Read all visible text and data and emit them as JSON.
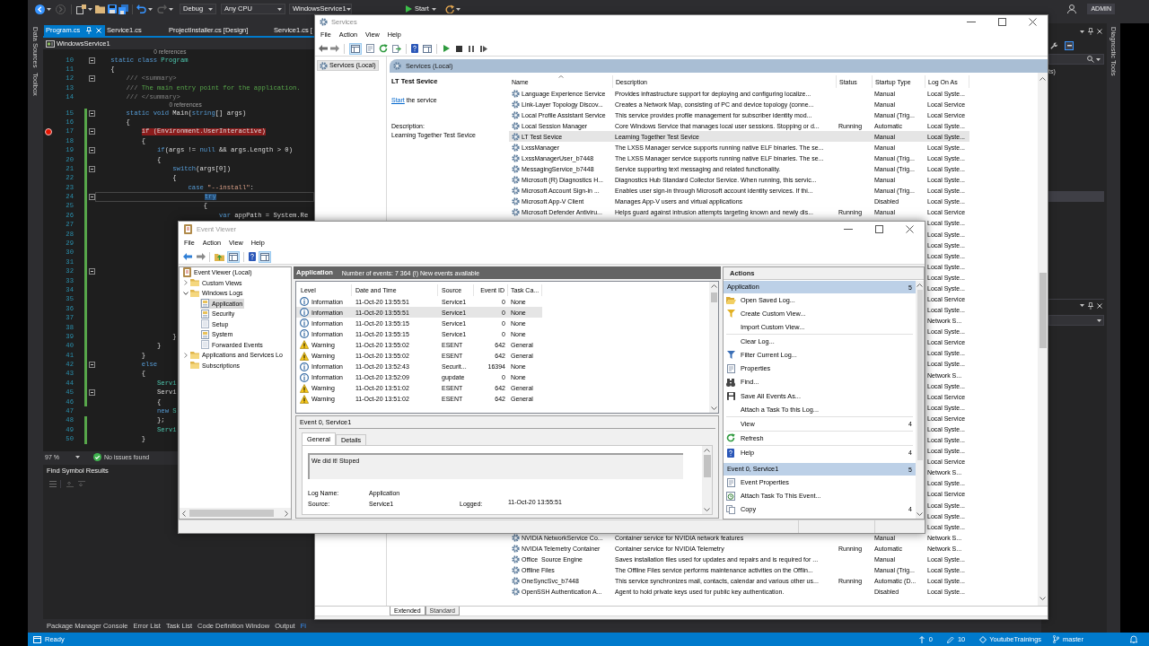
{
  "visual_studio": {
    "toolbar": {
      "configuration": "Debug",
      "platform": "Any CPU",
      "startup_project": "WindowsService1",
      "start_button": "Start",
      "account": "ADMIN"
    },
    "left_tool_tabs": [
      "Data Sources",
      "Toolbox"
    ],
    "right_tool_tabs": [
      "Diagnostic Tools"
    ],
    "document_tabs": [
      {
        "label": "Program.cs",
        "selected": true
      },
      {
        "label": "Service1.cs",
        "selected": false
      },
      {
        "label": "ProjectInstaller.cs [Design]",
        "selected": false
      },
      {
        "label": "Service1.cs [",
        "selected": false
      }
    ],
    "navigation_scope": "WindowsService1",
    "code_lines": [
      {
        "number": "10",
        "codelens": "0 references",
        "fold": true,
        "changed": false,
        "breakpoint": false,
        "current": false,
        "tokens": [
          {
            "text": "    static class ",
            "kind": "keyword"
          },
          {
            "text": "Program",
            "kind": "type"
          }
        ]
      },
      {
        "number": "11",
        "fold": false,
        "changed": false,
        "breakpoint": false,
        "current": false,
        "tokens": [
          {
            "text": "    {",
            "kind": "plain"
          }
        ]
      },
      {
        "number": "12",
        "fold": true,
        "changed": false,
        "breakpoint": false,
        "current": false,
        "tokens": [
          {
            "text": "        /// <summary>",
            "kind": "doc"
          }
        ]
      },
      {
        "number": "13",
        "fold": false,
        "changed": false,
        "breakpoint": false,
        "current": false,
        "tokens": [
          {
            "text": "        ///",
            "kind": "doc"
          },
          {
            "text": " The main entry point for the application.",
            "kind": "comment"
          }
        ]
      },
      {
        "number": "14",
        "fold": false,
        "changed": false,
        "breakpoint": false,
        "current": false,
        "tokens": [
          {
            "text": "        /// </summary>",
            "kind": "doc"
          }
        ]
      },
      {
        "number": "15",
        "codelens": "0 references",
        "fold": true,
        "changed": true,
        "breakpoint": false,
        "current": false,
        "tokens": [
          {
            "text": "        static void ",
            "kind": "keyword"
          },
          {
            "text": "Main(",
            "kind": "plain"
          },
          {
            "text": "string",
            "kind": "keyword"
          },
          {
            "text": "[] args)",
            "kind": "plain"
          }
        ]
      },
      {
        "number": "16",
        "fold": false,
        "changed": true,
        "breakpoint": false,
        "current": false,
        "tokens": [
          {
            "text": "        {",
            "kind": "plain"
          }
        ]
      },
      {
        "number": "17",
        "fold": true,
        "changed": true,
        "breakpoint": true,
        "current": false,
        "tokens": [
          {
            "text": "            if (Environment.UserInteractive)",
            "kind": "plain"
          }
        ]
      },
      {
        "number": "18",
        "fold": false,
        "changed": true,
        "breakpoint": false,
        "current": false,
        "tokens": [
          {
            "text": "            {",
            "kind": "plain"
          }
        ]
      },
      {
        "number": "19",
        "fold": true,
        "changed": true,
        "breakpoint": false,
        "current": false,
        "tokens": [
          {
            "text": "                if",
            "kind": "keyword"
          },
          {
            "text": "(args != ",
            "kind": "plain"
          },
          {
            "text": "null",
            "kind": "keyword"
          },
          {
            "text": " && args.Length > 0)",
            "kind": "plain"
          }
        ]
      },
      {
        "number": "20",
        "fold": false,
        "changed": true,
        "breakpoint": false,
        "current": false,
        "tokens": [
          {
            "text": "                {",
            "kind": "plain"
          }
        ]
      },
      {
        "number": "21",
        "fold": true,
        "changed": true,
        "breakpoint": false,
        "current": false,
        "tokens": [
          {
            "text": "                    switch",
            "kind": "keyword"
          },
          {
            "text": "(args[0])",
            "kind": "plain"
          }
        ]
      },
      {
        "number": "22",
        "fold": false,
        "changed": true,
        "breakpoint": false,
        "current": false,
        "tokens": [
          {
            "text": "                    {",
            "kind": "plain"
          }
        ]
      },
      {
        "number": "23",
        "fold": false,
        "changed": true,
        "breakpoint": false,
        "current": false,
        "tokens": [
          {
            "text": "                        case ",
            "kind": "keyword"
          },
          {
            "text": "\"--install\"",
            "kind": "string"
          },
          {
            "text": ":",
            "kind": "plain"
          }
        ]
      },
      {
        "number": "24",
        "fold": true,
        "changed": true,
        "breakpoint": false,
        "current": true,
        "tokens": [
          {
            "text": "                            try",
            "kind": "keyword"
          }
        ]
      },
      {
        "number": "25",
        "fold": false,
        "changed": true,
        "breakpoint": false,
        "current": false,
        "tokens": [
          {
            "text": "                            {",
            "kind": "plain"
          }
        ]
      },
      {
        "number": "26",
        "fold": false,
        "changed": true,
        "breakpoint": false,
        "current": false,
        "tokens": [
          {
            "text": "                                var ",
            "kind": "keyword"
          },
          {
            "text": "appPath = System.Re",
            "kind": "plain"
          }
        ]
      },
      {
        "number": "27",
        "fold": false,
        "changed": true,
        "breakpoint": false,
        "current": false
      },
      {
        "number": "28",
        "fold": false,
        "changed": true,
        "breakpoint": false,
        "current": false
      },
      {
        "number": "29",
        "fold": false,
        "changed": true,
        "breakpoint": false,
        "current": false
      },
      {
        "number": "30",
        "fold": false,
        "changed": true,
        "breakpoint": false,
        "current": false
      },
      {
        "number": "31",
        "fold": false,
        "changed": true,
        "breakpoint": false,
        "current": false
      },
      {
        "number": "32",
        "fold": true,
        "changed": true,
        "breakpoint": false,
        "current": false
      },
      {
        "number": "33",
        "fold": false,
        "changed": true,
        "breakpoint": false,
        "current": false
      },
      {
        "number": "34",
        "fold": false,
        "changed": true,
        "breakpoint": false,
        "current": false
      },
      {
        "number": "35",
        "fold": false,
        "changed": true,
        "breakpoint": false,
        "current": false
      },
      {
        "number": "36",
        "fold": false,
        "changed": true,
        "breakpoint": false,
        "current": false
      },
      {
        "number": "37",
        "fold": false,
        "changed": true,
        "breakpoint": false,
        "current": false
      },
      {
        "number": "38",
        "fold": false,
        "changed": true,
        "breakpoint": false,
        "current": false
      },
      {
        "number": "39",
        "fold": false,
        "changed": true,
        "breakpoint": false,
        "current": false,
        "tokens": [
          {
            "text": "                    }",
            "kind": "plain"
          }
        ]
      },
      {
        "number": "40",
        "fold": false,
        "changed": true,
        "breakpoint": false,
        "current": false,
        "tokens": [
          {
            "text": "                }",
            "kind": "plain"
          }
        ]
      },
      {
        "number": "41",
        "fold": false,
        "changed": true,
        "breakpoint": false,
        "current": false,
        "tokens": [
          {
            "text": "            }",
            "kind": "plain"
          }
        ]
      },
      {
        "number": "42",
        "fold": true,
        "changed": true,
        "breakpoint": false,
        "current": false,
        "tokens": [
          {
            "text": "            else",
            "kind": "keyword"
          }
        ]
      },
      {
        "number": "43",
        "fold": false,
        "changed": true,
        "breakpoint": false,
        "current": false,
        "tokens": [
          {
            "text": "            {",
            "kind": "plain"
          }
        ]
      },
      {
        "number": "44",
        "fold": false,
        "changed": true,
        "breakpoint": false,
        "current": false,
        "tokens": [
          {
            "text": "                Servi",
            "kind": "type"
          }
        ]
      },
      {
        "number": "45",
        "fold": true,
        "changed": true,
        "breakpoint": false,
        "current": false,
        "tokens": [
          {
            "text": "                Servi",
            "kind": "plain"
          }
        ]
      },
      {
        "number": "46",
        "fold": false,
        "changed": true,
        "breakpoint": false,
        "current": false,
        "tokens": [
          {
            "text": "                {",
            "kind": "plain"
          }
        ]
      },
      {
        "number": "47",
        "fold": false,
        "changed": false,
        "breakpoint": false,
        "current": false,
        "tokens": [
          {
            "text": "                new",
            "kind": "keyword"
          },
          {
            "text": " S",
            "kind": "type"
          }
        ]
      },
      {
        "number": "48",
        "fold": false,
        "changed": true,
        "breakpoint": false,
        "current": false,
        "tokens": [
          {
            "text": "                };",
            "kind": "plain"
          }
        ]
      },
      {
        "number": "49",
        "fold": false,
        "changed": true,
        "breakpoint": false,
        "current": false,
        "tokens": [
          {
            "text": "                Servi",
            "kind": "type"
          }
        ]
      },
      {
        "number": "50",
        "fold": false,
        "changed": true,
        "breakpoint": false,
        "current": false,
        "tokens": [
          {
            "text": "            }",
            "kind": "plain"
          }
        ]
      }
    ],
    "zoom_level": "97 %",
    "issues": "No issues found",
    "find_symbol_results": {
      "title": "Find Symbol Results"
    },
    "tool_tabs": [
      {
        "label": "Package Manager Console",
        "selected": false
      },
      {
        "label": "Error List",
        "selected": false
      },
      {
        "label": "Task List",
        "selected": false
      },
      {
        "label": "Code Definition Window",
        "selected": false
      },
      {
        "label": "Output",
        "selected": false
      },
      {
        "label": "Fi",
        "selected": true
      }
    ],
    "side_panel": {
      "text": "ts)"
    },
    "status_bar": {
      "text": "Ready",
      "outgoing": "0",
      "changes": "10",
      "repository": "YoutubeTrainings",
      "branch": "master"
    }
  },
  "services": {
    "title": "Services",
    "menu": [
      "File",
      "Action",
      "View",
      "Help"
    ],
    "toolbar": {
      "show_tree": true
    },
    "tree": [
      {
        "label": "Services (Local)",
        "selected": true
      }
    ],
    "header": "Services (Local)",
    "details": {
      "title": "LT Test Sevice",
      "action_link": "Start",
      "action_text": "the service",
      "description_label": "Description:",
      "description": "Learning Together Test Sevice"
    },
    "columns": [
      {
        "label": "Name",
        "sorted": true
      },
      {
        "label": "Description",
        "sorted": false
      },
      {
        "label": "Status",
        "sorted": false
      },
      {
        "label": "Startup Type",
        "sorted": false
      },
      {
        "label": "Log On As",
        "sorted": false
      }
    ],
    "rows": [
      {
        "name": "Language Experience Service",
        "description": "Provides infrastructure support for deploying and configuring localize...",
        "startup_type": "Manual",
        "log_on_as": "Local Syste...",
        "selected": false
      },
      {
        "name": "Link-Layer Topology Discov...",
        "description": "Creates a Network Map, consisting of PC and device topology (conne...",
        "startup_type": "Manual",
        "log_on_as": "Local Service",
        "selected": false
      },
      {
        "name": "Local Profile Assistant Service",
        "description": "This service provides profile management for subscriber identity mod...",
        "startup_type": "Manual (Trig...",
        "log_on_as": "Local Service",
        "selected": false
      },
      {
        "name": "Local Session Manager",
        "description": "Core Windows Service that manages local user sessions. Stopping or d...",
        "status": "Running",
        "startup_type": "Automatic",
        "log_on_as": "Local Syste...",
        "selected": false
      },
      {
        "name": "LT Test Sevice",
        "description": "Learning Together Test Sevice",
        "startup_type": "Manual",
        "log_on_as": "Local Syste...",
        "selected": true
      },
      {
        "name": "LxssManager",
        "description": "The LXSS Manager service supports running native ELF binaries. The se...",
        "startup_type": "Manual",
        "log_on_as": "Local Syste...",
        "selected": false
      },
      {
        "name": "LxssManagerUser_b7448",
        "description": "The LXSS Manager service supports running native ELF binaries. The se...",
        "startup_type": "Manual (Trig...",
        "log_on_as": "Local Syste...",
        "selected": false
      },
      {
        "name": "MessagingService_b7448",
        "description": "Service supporting text messaging and related functionality.",
        "startup_type": "Manual (Trig...",
        "log_on_as": "Local Syste...",
        "selected": false
      },
      {
        "name": "Microsoft (R) Diagnostics H...",
        "description": "Diagnostics Hub Standard Collector Service. When running, this servic...",
        "startup_type": "Manual",
        "log_on_as": "Local Syste...",
        "selected": false
      },
      {
        "name": "Microsoft Account Sign-in ...",
        "description": "Enables user sign-in through Microsoft account identity services. If thi...",
        "startup_type": "Manual (Trig...",
        "log_on_as": "Local Syste...",
        "selected": false
      },
      {
        "name": "Microsoft App-V Client",
        "description": "Manages App-V users and virtual applications",
        "startup_type": "Disabled",
        "log_on_as": "Local Syste...",
        "selected": false
      },
      {
        "name": "Microsoft Defender Antiviru...",
        "description": "Helps guard against intrusion attempts targeting known and newly dis...",
        "status": "Running",
        "startup_type": "Manual",
        "log_on_as": "Local Service",
        "selected": false
      },
      {
        "log_on_as": "Local Syste...",
        "selected": false
      },
      {
        "log_on_as": "Local Syste...",
        "selected": false
      },
      {
        "log_on_as": "Local Syste...",
        "selected": false
      },
      {
        "log_on_as": "Local Syste...",
        "selected": false
      },
      {
        "log_on_as": "Local Syste...",
        "selected": false
      },
      {
        "log_on_as": "Local Syste...",
        "selected": false
      },
      {
        "log_on_as": "Local Syste...",
        "selected": false
      },
      {
        "log_on_as": "Local Service",
        "selected": false
      },
      {
        "log_on_as": "Local Syste...",
        "selected": false
      },
      {
        "log_on_as": "Network S...",
        "selected": false
      },
      {
        "log_on_as": "Local Syste...",
        "selected": false
      },
      {
        "log_on_as": "Local Service",
        "selected": false
      },
      {
        "log_on_as": "Local Syste...",
        "selected": false
      },
      {
        "log_on_as": "Local Syste...",
        "selected": false
      },
      {
        "log_on_as": "Network S...",
        "selected": false
      },
      {
        "log_on_as": "Local Syste...",
        "selected": false
      },
      {
        "log_on_as": "Local Service",
        "selected": false
      },
      {
        "log_on_as": "Local Syste...",
        "selected": false
      },
      {
        "log_on_as": "Local Service",
        "selected": false
      },
      {
        "log_on_as": "Local Syste...",
        "selected": false
      },
      {
        "log_on_as": "Local Syste...",
        "selected": false
      },
      {
        "log_on_as": "Local Syste...",
        "selected": false
      },
      {
        "log_on_as": "Local Service",
        "selected": false
      },
      {
        "log_on_as": "Network S...",
        "selected": false
      },
      {
        "log_on_as": "Local Syste...",
        "selected": false
      },
      {
        "log_on_as": "Local Service",
        "selected": false
      },
      {
        "log_on_as": "Local Syste...",
        "selected": false
      },
      {
        "log_on_as": "Local Syste...",
        "selected": false
      },
      {
        "log_on_as": "Local Syste...",
        "selected": false
      },
      {
        "name": "NVIDIA NetworkService Co...",
        "description": "Container service for NVIDIA network features",
        "startup_type": "Manual",
        "log_on_as": "Network S...",
        "selected": false
      },
      {
        "name": "NVIDIA Telemetry Container",
        "description": "Container service for NVIDIA Telemetry",
        "status": "Running",
        "startup_type": "Automatic",
        "log_on_as": "Network S...",
        "selected": false
      },
      {
        "name": "Office  Source Engine",
        "description": "Saves installation files used for updates and repairs and is required for ...",
        "startup_type": "Manual",
        "log_on_as": "Local Syste...",
        "selected": false
      },
      {
        "name": "Offline Files",
        "description": "The Offline Files service performs maintenance activities on the Offlin...",
        "startup_type": "Manual (Trig...",
        "log_on_as": "Local Syste...",
        "selected": false
      },
      {
        "name": "OneSyncSvc_b7448",
        "description": "This service synchronizes mail, contacts, calendar and various other us...",
        "status": "Running",
        "startup_type": "Automatic (D...",
        "log_on_as": "Local Syste...",
        "selected": false
      },
      {
        "name": "OpenSSH Authentication A...",
        "description": "Agent to hold private keys used for public key authentication.",
        "startup_type": "Disabled",
        "log_on_as": "Local Syste...",
        "selected": false
      }
    ],
    "view_tabs": [
      {
        "label": "Extended",
        "selected": true
      },
      {
        "label": "Standard",
        "selected": false
      }
    ]
  },
  "event_viewer": {
    "title": "Event Viewer",
    "menu": [
      "File",
      "Action",
      "View",
      "Help"
    ],
    "toolbar": {
      "show_tree": true,
      "show_actions": true
    },
    "tree": [
      {
        "label": "Event Viewer (Local)",
        "kind": "root",
        "selected": false,
        "children": [
          {
            "label": "Custom Views",
            "kind": "folder",
            "expanded": false,
            "selected": false
          },
          {
            "label": "Windows Logs",
            "kind": "folder",
            "expanded": true,
            "selected": false,
            "children": [
              {
                "label": "Application",
                "kind": "log",
                "selected": true
              },
              {
                "label": "Security",
                "kind": "log",
                "selected": false
              },
              {
                "label": "Setup",
                "kind": "plain_log",
                "selected": false
              },
              {
                "label": "System",
                "kind": "log",
                "selected": false
              },
              {
                "label": "Forwarded Events",
                "kind": "plain_log",
                "selected": false
              }
            ]
          },
          {
            "label": "Applications and Services Lo",
            "kind": "folder",
            "expanded": false,
            "selected": false
          },
          {
            "label": "Subscriptions",
            "kind": "folder",
            "selected": false
          }
        ]
      }
    ],
    "log_header": {
      "name": "Application",
      "summary": "Number of events: 7 364 (!) New events available"
    },
    "columns": [
      "Level",
      "Date and Time",
      "Source",
      "Event ID",
      "Task Ca..."
    ],
    "events": [
      {
        "kind": "information",
        "severity": "Information",
        "date_time": "11-Oct-20 13:55:51",
        "source": "Service1",
        "event_id": "0",
        "task_category": "None",
        "selected": false
      },
      {
        "kind": "information",
        "severity": "Information",
        "date_time": "11-Oct-20 13:55:51",
        "source": "Service1",
        "event_id": "0",
        "task_category": "None",
        "selected": true
      },
      {
        "kind": "information",
        "severity": "Information",
        "date_time": "11-Oct-20 13:55:15",
        "source": "Service1",
        "event_id": "0",
        "task_category": "None",
        "selected": false
      },
      {
        "kind": "information",
        "severity": "Information",
        "date_time": "11-Oct-20 13:55:15",
        "source": "Service1",
        "event_id": "0",
        "task_category": "None",
        "selected": false
      },
      {
        "kind": "warning",
        "severity": "Warning",
        "date_time": "11-Oct-20 13:55:02",
        "source": "ESENT",
        "event_id": "642",
        "task_category": "General",
        "selected": false
      },
      {
        "kind": "warning",
        "severity": "Warning",
        "date_time": "11-Oct-20 13:55:02",
        "source": "ESENT",
        "event_id": "642",
        "task_category": "General",
        "selected": false
      },
      {
        "kind": "information",
        "severity": "Information",
        "date_time": "11-Oct-20 13:52:43",
        "source": "Securit...",
        "event_id": "16394",
        "task_category": "None",
        "selected": false
      },
      {
        "kind": "information",
        "severity": "Information",
        "date_time": "11-Oct-20 13:52:09",
        "source": "gupdate",
        "event_id": "0",
        "task_category": "None",
        "selected": false
      },
      {
        "kind": "warning",
        "severity": "Warning",
        "date_time": "11-Oct-20 13:51:02",
        "source": "ESENT",
        "event_id": "642",
        "task_category": "General",
        "selected": false
      },
      {
        "kind": "warning",
        "severity": "Warning",
        "date_time": "11-Oct-20 13:51:02",
        "source": "ESENT",
        "event_id": "642",
        "task_category": "General",
        "selected": false
      }
    ],
    "event_detail": {
      "title": "Event 0, Service1",
      "tabs": [
        {
          "label": "General",
          "selected": true
        },
        {
          "label": "Details",
          "selected": false
        }
      ],
      "message": "We did it! Stoped",
      "fields": [
        {
          "label": "Log Name:",
          "value": "Application"
        },
        {
          "label": "Source:",
          "value": "Service1",
          "extra_label": "Logged:",
          "extra_value": "11-Oct-20 13:55:51"
        }
      ]
    },
    "actions": {
      "title": "Actions",
      "groups": [
        {
          "title": "Application",
          "mark": "5",
          "items": [
            {
              "kind": "command",
              "label": "Open Saved Log..."
            },
            {
              "kind": "command",
              "label": "Create Custom View..."
            },
            {
              "kind": "command",
              "label": "Import Custom View..."
            },
            {
              "kind": "separator"
            },
            {
              "kind": "command",
              "label": "Clear Log..."
            },
            {
              "kind": "command",
              "label": "Filter Current Log..."
            },
            {
              "kind": "command",
              "label": "Properties"
            },
            {
              "kind": "command",
              "label": "Find..."
            },
            {
              "kind": "command",
              "label": "Save All Events As..."
            },
            {
              "kind": "command",
              "label": "Attach a Task To this Log..."
            },
            {
              "kind": "separator"
            },
            {
              "kind": "command",
              "label": "View",
              "mark": "4"
            },
            {
              "kind": "separator"
            },
            {
              "kind": "command",
              "label": "Refresh"
            },
            {
              "kind": "separator"
            },
            {
              "kind": "command",
              "label": "Help",
              "mark": "4"
            }
          ]
        },
        {
          "title": "Event 0, Service1",
          "mark": "5",
          "items": [
            {
              "kind": "command",
              "label": "Event Properties"
            },
            {
              "kind": "command",
              "label": "Attach Task To This Event..."
            },
            {
              "kind": "command",
              "label": "Copy",
              "mark": "4"
            }
          ]
        }
      ]
    }
  }
}
